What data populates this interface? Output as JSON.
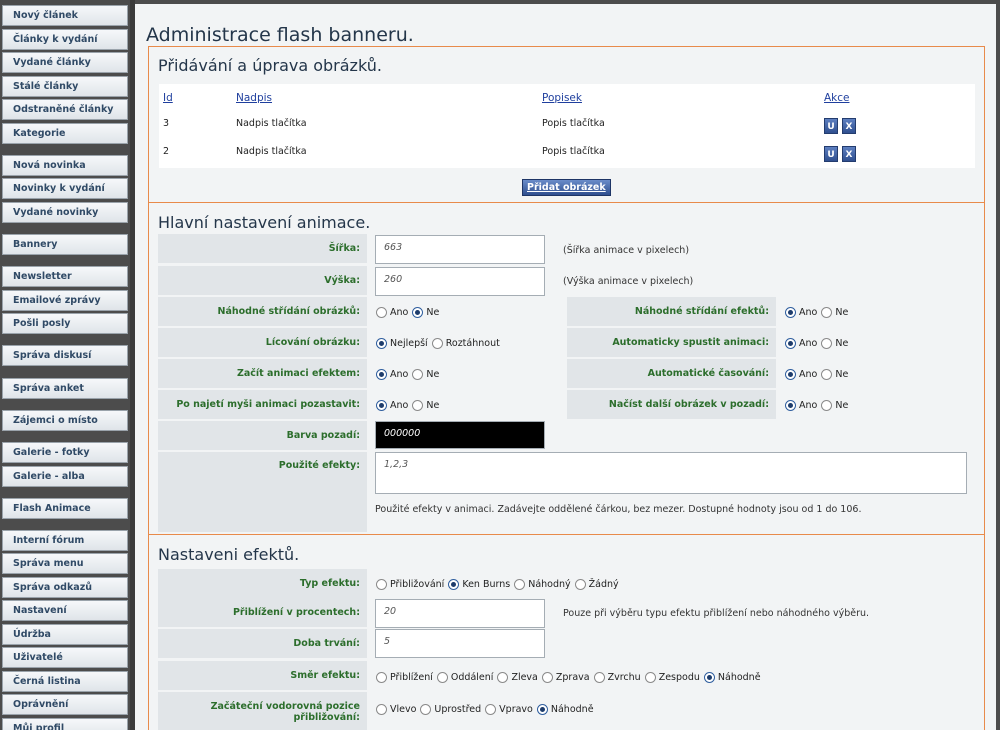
{
  "sidebar": {
    "items": [
      "Nový článek",
      "Články k vydání",
      "Vydané články",
      "Stálé články",
      "Odstraněné články",
      "Kategorie",
      "Nová novinka",
      "Novinky k vydání",
      "Vydané novinky",
      "Bannery",
      "Newsletter",
      "Emailové zprávy",
      "Pošli posly",
      "Správa diskusí",
      "Správa anket",
      "Zájemci o místo",
      "Galerie - fotky",
      "Galerie - alba",
      "Flash Animace",
      "Interní fórum",
      "Správa menu",
      "Správa odkazů",
      "Nastavení",
      "Údržba",
      "Uživatelé",
      "Černá listina",
      "Oprávnění",
      "Můj profil"
    ]
  },
  "page": {
    "title": "Administrace flash banneru."
  },
  "images_section": {
    "title": "Přidávání a úprava obrázků.",
    "headers": {
      "id": "Id",
      "title": "Nadpis",
      "desc": "Popisek",
      "actions": "Akce"
    },
    "rows": [
      {
        "id": "3",
        "title": "Nadpis tlačítka",
        "desc": "Popis tlačítka"
      },
      {
        "id": "2",
        "title": "Nadpis tlačítka",
        "desc": "Popis tlačítka"
      }
    ],
    "edit_label": "U",
    "delete_label": "X",
    "add_button": "Přidat obrázek"
  },
  "main_settings": {
    "title": "Hlavní nastavení animace.",
    "width": {
      "label": "Šířka:",
      "value": "663",
      "hint": "(Šířka animace v pixelech)"
    },
    "height": {
      "label": "Výška:",
      "value": "260",
      "hint": "(Výška animace v pixelech)"
    },
    "random_images": {
      "label": "Náhodné střídání obrázků:",
      "options": [
        "Ano",
        "Ne"
      ],
      "selected": 1
    },
    "random_effects": {
      "label": "Náhodné střídání efektů:",
      "options": [
        "Ano",
        "Ne"
      ],
      "selected": 0
    },
    "fitting": {
      "label": "Lícování obrázku:",
      "options": [
        "Nejlepší",
        "Roztáhnout"
      ],
      "selected": 0
    },
    "autostart": {
      "label": "Automaticky spustit animaci:",
      "options": [
        "Ano",
        "Ne"
      ],
      "selected": 0
    },
    "start_effect": {
      "label": "Začít animaci efektem:",
      "options": [
        "Ano",
        "Ne"
      ],
      "selected": 0
    },
    "auto_timing": {
      "label": "Automatické časování:",
      "options": [
        "Ano",
        "Ne"
      ],
      "selected": 0
    },
    "pause_hover": {
      "label": "Po najetí myši animaci pozastavit:",
      "options": [
        "Ano",
        "Ne"
      ],
      "selected": 0
    },
    "preload": {
      "label": "Načíst další obrázek v pozadí:",
      "options": [
        "Ano",
        "Ne"
      ],
      "selected": 0
    },
    "bg_color": {
      "label": "Barva pozadí:",
      "value": "000000"
    },
    "effects_used": {
      "label": "Použité efekty:",
      "value": "1,2,3",
      "hint": "Použité efekty v animaci. Zadávejte oddělené čárkou, bez mezer. Dostupné hodnoty jsou od 1 do 106."
    }
  },
  "effects_settings": {
    "title": "Nastaveni efektů.",
    "type": {
      "label": "Typ efektu:",
      "options": [
        "Přibližování",
        "Ken Burns",
        "Náhodný",
        "Žádný"
      ],
      "selected": 1
    },
    "zoom": {
      "label": "Přiblížení v procentech:",
      "value": "20",
      "hint": "Pouze při výběru typu efektu přiblížení nebo náhodného výběru."
    },
    "duration": {
      "label": "Doba trvání:",
      "value": "5"
    },
    "direction": {
      "label": "Směr efektu:",
      "options": [
        "Přiblížení",
        "Oddálení",
        "Zleva",
        "Zprava",
        "Zvrchu",
        "Zespodu",
        "Náhodně"
      ],
      "selected": 6
    },
    "h_position": {
      "label": "Začáteční vodorovná pozice přibližování:",
      "options": [
        "Vlevo",
        "Uprostřed",
        "Vpravo",
        "Náhodně"
      ],
      "selected": 3
    }
  }
}
